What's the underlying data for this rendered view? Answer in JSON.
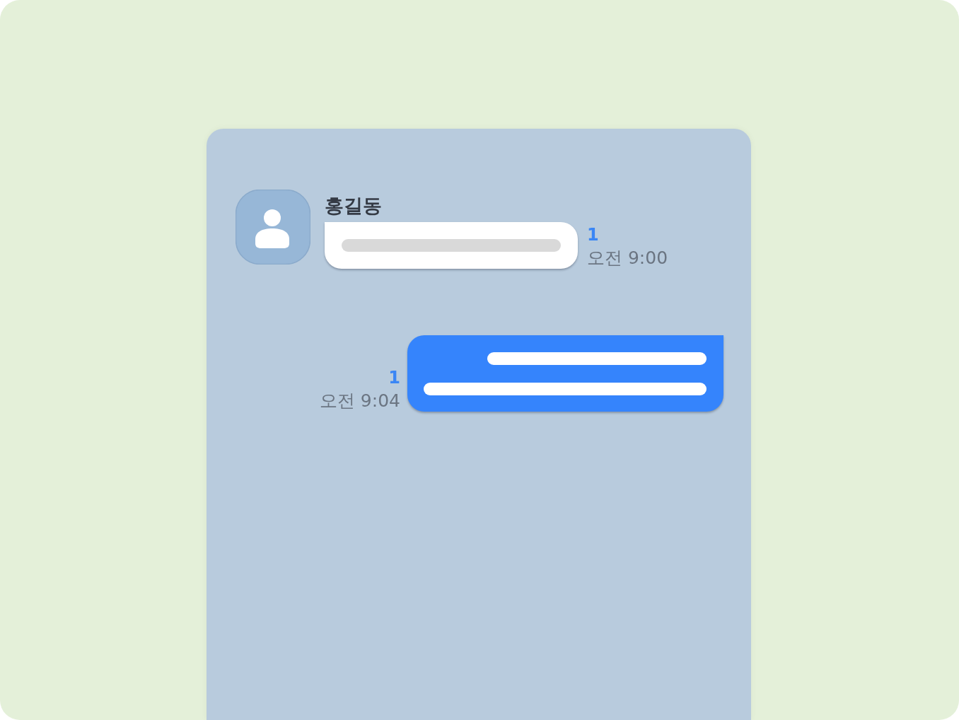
{
  "messages": [
    {
      "kind": "received",
      "sender": "홍길동",
      "unread": "1",
      "time": "오전 9:00"
    },
    {
      "kind": "sent",
      "unread": "1",
      "time": "오전 9:04"
    }
  ]
}
